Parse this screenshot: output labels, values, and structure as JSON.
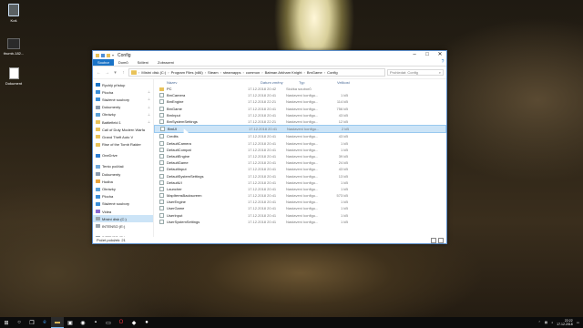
{
  "desktop": {
    "icons": [
      {
        "label": "Koš",
        "kind": "recycle-bin"
      },
      {
        "label": "thumb-182...",
        "kind": "app"
      },
      {
        "label": "Dokument",
        "kind": "document"
      }
    ]
  },
  "window": {
    "title": "Config",
    "ribbon_tabs": [
      "Soubor",
      "Domů",
      "Sdílení",
      "Zobrazení"
    ],
    "active_tab": "Soubor",
    "breadcrumb": [
      "Místní disk (C:)",
      "Program Files (x86)",
      "Steam",
      "steamapps",
      "common",
      "Batman Arkham Knight",
      "BmGame",
      "Config"
    ],
    "search_placeholder": "Prohledat: Config",
    "columns": {
      "name": "Název",
      "date": "Datum změny",
      "type": "Typ",
      "size": "Velikost"
    },
    "files": [
      {
        "name": "PC",
        "date": "17.12.2018 20:42",
        "type": "Složka souborů",
        "size": "",
        "folder": true
      },
      {
        "name": "BmCamera",
        "date": "17.12.2018 20:41",
        "type": "Nastavení konfigu...",
        "size": "1 kB"
      },
      {
        "name": "BmEngine",
        "date": "17.12.2018 22:21",
        "type": "Nastavení konfigu...",
        "size": "114 kB"
      },
      {
        "name": "BmGame",
        "date": "17.12.2018 20:41",
        "type": "Nastavení konfigu...",
        "size": "756 kB"
      },
      {
        "name": "BmInput",
        "date": "17.12.2018 20:41",
        "type": "Nastavení konfigu...",
        "size": "43 kB"
      },
      {
        "name": "BmSystemSettings",
        "date": "17.12.2018 22:21",
        "type": "Nastavení konfigu...",
        "size": "12 kB"
      },
      {
        "name": "BmUI",
        "date": "17.12.2018 20:41",
        "type": "Nastavení konfigu...",
        "size": "2 kB",
        "selected": true
      },
      {
        "name": "Credits",
        "date": "17.12.2018 20:41",
        "type": "Nastavení konfigu...",
        "size": "43 kB"
      },
      {
        "name": "DefaultCamera",
        "date": "17.12.2018 20:41",
        "type": "Nastavení konfigu...",
        "size": "1 kB"
      },
      {
        "name": "DefaultCompat",
        "date": "17.12.2018 20:41",
        "type": "Nastavení konfigu...",
        "size": "1 kB"
      },
      {
        "name": "DefaultEngine",
        "date": "17.12.2018 20:41",
        "type": "Nastavení konfigu...",
        "size": "39 kB"
      },
      {
        "name": "DefaultGame",
        "date": "17.12.2018 20:41",
        "type": "Nastavení konfigu...",
        "size": "24 kB"
      },
      {
        "name": "DefaultInput",
        "date": "17.12.2018 20:41",
        "type": "Nastavení konfigu...",
        "size": "43 kB"
      },
      {
        "name": "DefaultSystemSettings",
        "date": "17.12.2018 20:41",
        "type": "Nastavení konfigu...",
        "size": "13 kB"
      },
      {
        "name": "DefaultUI",
        "date": "17.12.2018 20:41",
        "type": "Nastavení konfigu...",
        "size": "1 kB"
      },
      {
        "name": "Launcher",
        "date": "17.12.2018 20:41",
        "type": "Nastavení konfigu...",
        "size": "1 kB"
      },
      {
        "name": "MapItemsBackscreen",
        "date": "17.12.2018 20:41",
        "type": "Nastavení konfigu...",
        "size": "573 kB"
      },
      {
        "name": "UserEngine",
        "date": "17.12.2018 20:41",
        "type": "Nastavení konfigu...",
        "size": "1 kB"
      },
      {
        "name": "UserGame",
        "date": "17.12.2018 20:41",
        "type": "Nastavení konfigu...",
        "size": "1 kB"
      },
      {
        "name": "UserInput",
        "date": "17.12.2018 20:41",
        "type": "Nastavení konfigu...",
        "size": "1 kB"
      },
      {
        "name": "UserSystemSettings",
        "date": "17.12.2018 20:41",
        "type": "Nastavení konfigu...",
        "size": "1 kB"
      }
    ],
    "nav": [
      {
        "label": "Rychlý přístup",
        "icon": "star-icon",
        "color": "#1a73c7",
        "pin": false
      },
      {
        "label": "Plocha",
        "icon": "desktop-icon",
        "color": "#3b8ed8",
        "pin": true
      },
      {
        "label": "Stažené soubory",
        "icon": "download-icon",
        "color": "#3b8ed8",
        "pin": true
      },
      {
        "label": "Dokumenty",
        "icon": "documents-icon",
        "color": "#8a9bb0",
        "pin": true
      },
      {
        "label": "Obrázky",
        "icon": "pictures-icon",
        "color": "#5aa0d8",
        "pin": true
      },
      {
        "label": "Battlefield 1",
        "icon": "folder-icon",
        "color": "#e8c25a",
        "pin": true
      },
      {
        "label": "Call of Duty Modern Warfa",
        "icon": "folder-icon",
        "color": "#e8c25a",
        "pin": false
      },
      {
        "label": "Grand Theft Auto V",
        "icon": "folder-icon",
        "color": "#e8c25a",
        "pin": false
      },
      {
        "label": "Rise of the Tomb Raider",
        "icon": "folder-icon",
        "color": "#e8c25a",
        "pin": false
      },
      {
        "label": "",
        "icon": "",
        "color": "",
        "pin": false
      },
      {
        "label": "OneDrive",
        "icon": "cloud-icon",
        "color": "#2b7cd3",
        "pin": false
      },
      {
        "label": "",
        "icon": "",
        "color": "",
        "pin": false
      },
      {
        "label": "Tento počítač",
        "icon": "computer-icon",
        "color": "#6fa8dc",
        "pin": false
      },
      {
        "label": "Dokumenty",
        "icon": "documents-icon",
        "color": "#8a9bb0",
        "pin": false
      },
      {
        "label": "Hudba",
        "icon": "music-icon",
        "color": "#e8a33c",
        "pin": false
      },
      {
        "label": "Obrázky",
        "icon": "pictures-icon",
        "color": "#5aa0d8",
        "pin": false
      },
      {
        "label": "Plocha",
        "icon": "desktop-icon",
        "color": "#3b8ed8",
        "pin": false
      },
      {
        "label": "Stažené soubory",
        "icon": "download-icon",
        "color": "#3b8ed8",
        "pin": false
      },
      {
        "label": "Videa",
        "icon": "video-icon",
        "color": "#8a6ad0",
        "pin": false
      },
      {
        "label": "Místní disk (C:)",
        "icon": "drive-icon",
        "color": "#9aa4ad",
        "pin": false,
        "selected": true
      },
      {
        "label": "INTENSO (E:)",
        "icon": "drive-icon",
        "color": "#9aa4ad",
        "pin": false
      },
      {
        "label": "",
        "icon": "",
        "color": "",
        "pin": false
      },
      {
        "label": "INTENSO (E:)",
        "icon": "usb-icon",
        "color": "#9aa4ad",
        "pin": false
      }
    ],
    "status_text": "Počet položek: 21"
  },
  "taskbar": {
    "apps": [
      "windows-start-icon",
      "search-icon",
      "task-view-icon",
      "edge-icon",
      "explorer-icon",
      "store-icon",
      "media-icon",
      "app-icon",
      "terminal-icon",
      "opera-icon",
      "app2-icon",
      "steam-icon"
    ],
    "active_index": 4,
    "time": "22:22",
    "date": "17.12.2018",
    "accent": "#76b9ed"
  }
}
